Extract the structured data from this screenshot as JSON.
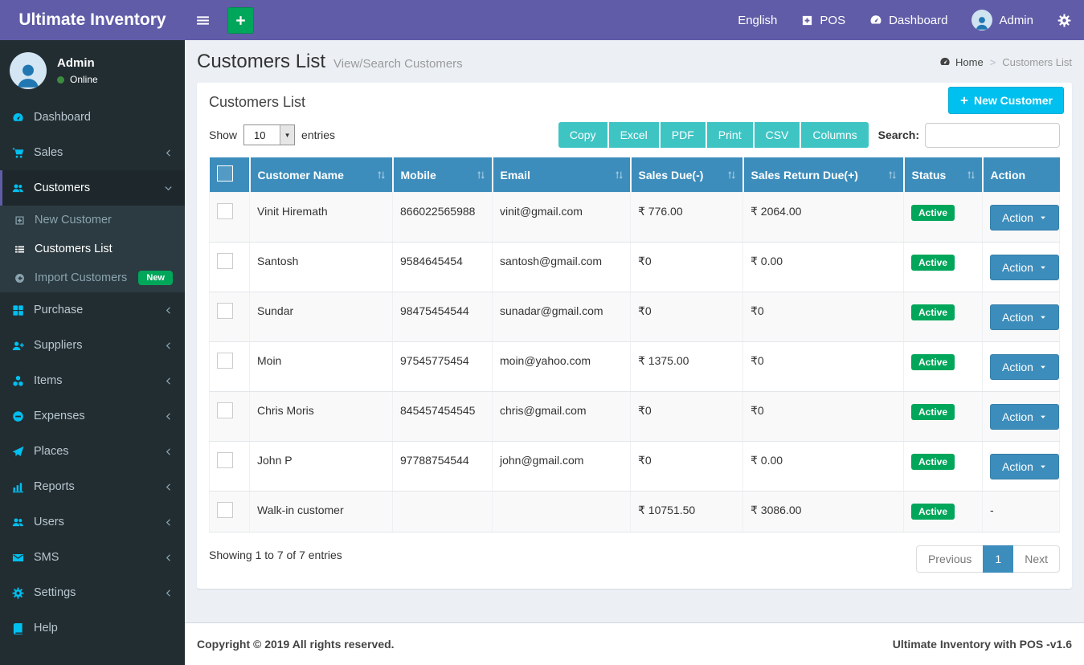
{
  "navbar": {
    "brand": "Ultimate Inventory",
    "items": {
      "language": "English",
      "pos": "POS",
      "dashboard": "Dashboard",
      "user": "Admin"
    }
  },
  "sidebar": {
    "user": {
      "name": "Admin",
      "status": "Online"
    },
    "menu": [
      {
        "label": "Dashboard",
        "icon": "gauge-icon"
      },
      {
        "label": "Sales",
        "icon": "cart-icon",
        "chevron": "left"
      },
      {
        "label": "Customers",
        "icon": "users-icon",
        "chevron": "down",
        "active": true,
        "submenu": [
          {
            "label": "New Customer",
            "icon": "plus-square-icon"
          },
          {
            "label": "Customers List",
            "icon": "list-icon",
            "active": true
          },
          {
            "label": "Import Customers",
            "icon": "arrow-circle-left-icon",
            "badge": "New"
          }
        ]
      },
      {
        "label": "Purchase",
        "icon": "grid-icon",
        "chevron": "left"
      },
      {
        "label": "Suppliers",
        "icon": "user-plus-icon",
        "chevron": "left"
      },
      {
        "label": "Items",
        "icon": "cubes-icon",
        "chevron": "left"
      },
      {
        "label": "Expenses",
        "icon": "minus-circle-icon",
        "chevron": "left"
      },
      {
        "label": "Places",
        "icon": "paper-plane-icon",
        "chevron": "left"
      },
      {
        "label": "Reports",
        "icon": "bar-chart-icon",
        "chevron": "left"
      },
      {
        "label": "Users",
        "icon": "users-icon",
        "chevron": "left"
      },
      {
        "label": "SMS",
        "icon": "envelope-icon",
        "chevron": "left"
      },
      {
        "label": "Settings",
        "icon": "gears-icon",
        "chevron": "left"
      },
      {
        "label": "Help",
        "icon": "book-icon"
      }
    ]
  },
  "page": {
    "title": "Customers List",
    "subtitle": "View/Search Customers",
    "breadcrumb": {
      "home": "Home",
      "current": "Customers List"
    }
  },
  "panel": {
    "title": "Customers List",
    "new_customer_label": "New Customer",
    "length_menu": {
      "show": "Show",
      "value": "10",
      "entries": "entries"
    },
    "export_buttons": [
      "Copy",
      "Excel",
      "PDF",
      "Print",
      "CSV",
      "Columns"
    ],
    "search_label": "Search:",
    "search_value": "",
    "table": {
      "headers": [
        {
          "label": "Customer Name",
          "sortable": true
        },
        {
          "label": "Mobile",
          "sortable": true
        },
        {
          "label": "Email",
          "sortable": true
        },
        {
          "label": "Sales Due(-)",
          "sortable": true
        },
        {
          "label": "Sales Return Due(+)",
          "sortable": true
        },
        {
          "label": "Status",
          "sortable": true
        },
        {
          "label": "Action",
          "sortable": false
        }
      ],
      "rows": [
        {
          "name": "Vinit Hiremath",
          "mobile": "866022565988",
          "email": "vinit@gmail.com",
          "sales_due": "₹ 776.00",
          "sales_return_due": "₹ 2064.00",
          "status": "Active",
          "action": "Action",
          "has_action": true
        },
        {
          "name": "Santosh",
          "mobile": "9584645454",
          "email": "santosh@gmail.com",
          "sales_due": "₹0",
          "sales_return_due": "₹ 0.00",
          "status": "Active",
          "action": "Action",
          "has_action": true
        },
        {
          "name": "Sundar",
          "mobile": "98475454544",
          "email": "sunadar@gmail.com",
          "sales_due": "₹0",
          "sales_return_due": "₹0",
          "status": "Active",
          "action": "Action",
          "has_action": true
        },
        {
          "name": "Moin",
          "mobile": "97545775454",
          "email": "moin@yahoo.com",
          "sales_due": "₹ 1375.00",
          "sales_return_due": "₹0",
          "status": "Active",
          "action": "Action",
          "has_action": true
        },
        {
          "name": "Chris Moris",
          "mobile": "845457454545",
          "email": "chris@gmail.com",
          "sales_due": "₹0",
          "sales_return_due": "₹0",
          "status": "Active",
          "action": "Action",
          "has_action": true
        },
        {
          "name": "John P",
          "mobile": "97788754544",
          "email": "john@gmail.com",
          "sales_due": "₹0",
          "sales_return_due": "₹ 0.00",
          "status": "Active",
          "action": "Action",
          "has_action": true
        },
        {
          "name": "Walk-in customer",
          "mobile": "",
          "email": "",
          "sales_due": "₹ 10751.50",
          "sales_return_due": "₹ 3086.00",
          "status": "Active",
          "action": "-",
          "has_action": false
        }
      ]
    },
    "info": "Showing 1 to 7 of 7 entries",
    "pagination": {
      "previous": "Previous",
      "page": "1",
      "next": "Next"
    }
  },
  "footer": {
    "copyright": "Copyright © 2019 All rights reserved.",
    "version": "Ultimate Inventory with POS -v1.6"
  },
  "colors": {
    "navbar_purple": "#605ca8",
    "sidebar_dark": "#222d32",
    "accent_cyan": "#00c0ef",
    "success_green": "#00a65a",
    "export_teal": "#3fc4c4",
    "table_header_blue": "#3c8dbc"
  }
}
